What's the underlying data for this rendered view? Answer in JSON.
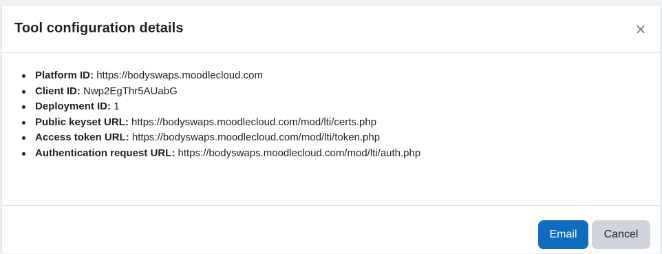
{
  "dialog": {
    "title": "Tool configuration details",
    "close_label": "×"
  },
  "details": [
    {
      "term": "Platform ID:",
      "value": "https://bodyswaps.moodlecloud.com"
    },
    {
      "term": "Client ID:",
      "value": "Nwp2EgThr5AUabG"
    },
    {
      "term": "Deployment ID:",
      "value": "1"
    },
    {
      "term": "Public keyset URL:",
      "value": "https://bodyswaps.moodlecloud.com/mod/lti/certs.php"
    },
    {
      "term": "Access token URL:",
      "value": "https://bodyswaps.moodlecloud.com/mod/lti/token.php"
    },
    {
      "term": "Authentication request URL:",
      "value": "https://bodyswaps.moodlecloud.com/mod/lti/auth.php"
    }
  ],
  "footer": {
    "email_label": "Email",
    "cancel_label": "Cancel"
  },
  "colors": {
    "primary": "#0f6cbf",
    "secondary": "#ced4da",
    "text": "#1d2125"
  }
}
